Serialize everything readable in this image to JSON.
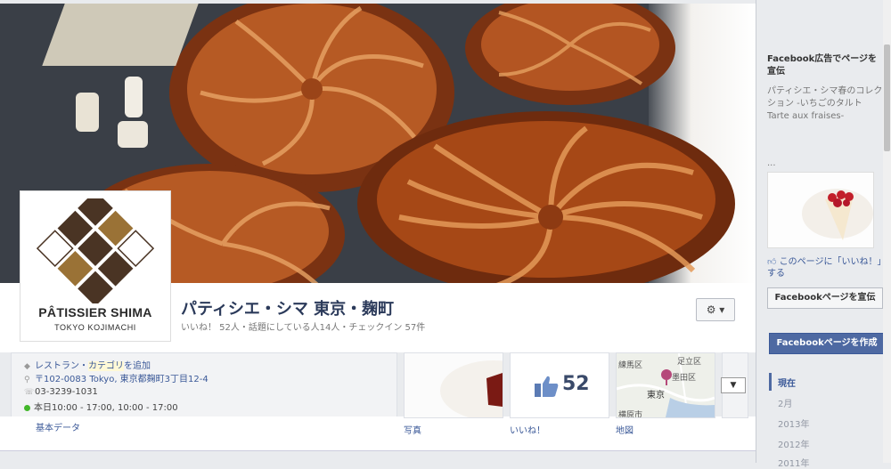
{
  "page": {
    "title": "パティシエ・シマ 東京・麹町",
    "stats": "いいね！ 52人・話題にしている人14人・チェックイン 57件"
  },
  "logo": {
    "name": "PÂTISSIER SHIMA",
    "sub": "TOKYO KOJIMACHI",
    "colors": {
      "dark": "#4a3424",
      "gold": "#9a7236"
    }
  },
  "info": {
    "category_prefix": "レストラン・",
    "category_highlight": "カテゴリ",
    "category_suffix": "を追加",
    "address": "〒102-0083 Tokyo, 東京都麹町3丁目12-4",
    "phone": "03-3239-1031",
    "hours": "本日10:00 - 17:00, 10:00 - 17:00",
    "basic_data": "基本データ"
  },
  "tiles": {
    "photos_label": "写真",
    "likes_count": "52",
    "likes_label": "いいね！",
    "map_label": "地図",
    "map_places": [
      "練馬区",
      "足立区",
      "墨田区",
      "東京",
      "横原市"
    ]
  },
  "toolbar": {
    "gear": "⚙ ▾",
    "expand": "▼"
  },
  "sidebar": {
    "ad_heading": "Facebook広告でページを宣伝",
    "ad_text": "パティシエ・シマ春のコレクション -いちごのタルトTarte aux fraises-",
    "ellipsis": "...",
    "like_text": "このページに「いいね！」する",
    "promote_button": "Facebookページを宣伝",
    "create_button": "Facebookページを作成",
    "timeline": [
      "現在",
      "2月",
      "2013年",
      "2012年",
      "2011年"
    ]
  },
  "colors": {
    "fb_blue": "#3b5998",
    "header_title": "#2b3a5a",
    "crust": "#8a3d17"
  }
}
